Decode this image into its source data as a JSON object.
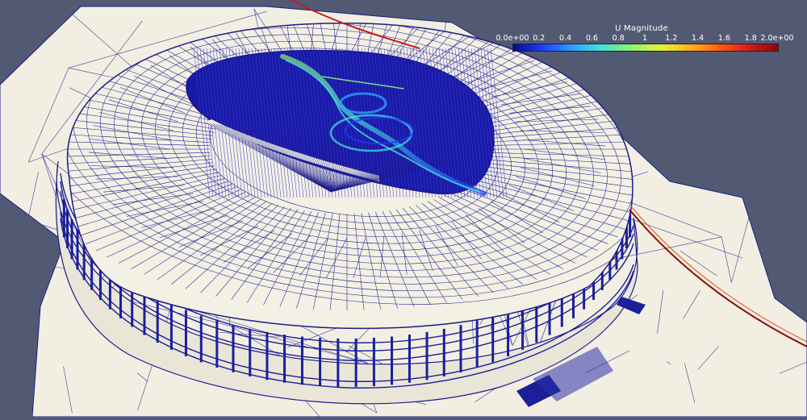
{
  "legend": {
    "title": "U Magnitude",
    "ticks": [
      "0.0e+00",
      "0.2",
      "0.4",
      "0.6",
      "0.8",
      "1",
      "1.2",
      "1.4",
      "1.6",
      "1.8",
      "2.0e+00"
    ],
    "range": [
      0,
      2
    ],
    "colors": [
      "#0a0a8a",
      "#1e3cff",
      "#2aa0ff",
      "#44e0d8",
      "#8ef07a",
      "#e6f03a",
      "#ffb21e",
      "#ff5a14",
      "#d21e1e",
      "#8a0a0a"
    ]
  },
  "scene": {
    "background": "#525a73",
    "ground_color": "#f2efe2",
    "mesh_color": "#1c1c8c",
    "stand_color": "#1b1f9a"
  }
}
